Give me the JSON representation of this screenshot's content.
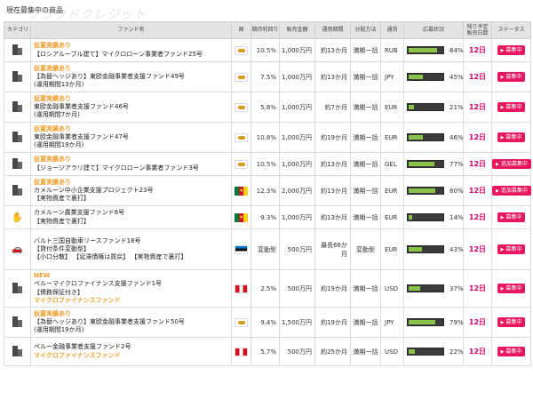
{
  "page": {
    "title": "現在募集中の商品"
  },
  "columns": {
    "category": "カテゴリ",
    "fund": "ファンド名",
    "country": "国",
    "yield": "期待利回り",
    "amount": "販売金額",
    "period": "運用期間",
    "distribution": "分配方法",
    "currency": "通貨",
    "progress": "応募状況",
    "days_line1": "残り予定",
    "days_line2": "販売日数",
    "status": "ステータス"
  },
  "colors": {
    "accent_pink": "#e8175d",
    "days_pink": "#d6006e",
    "badge_orange": "#f0a030",
    "bar_green": "#8bc34a"
  },
  "rows": [
    {
      "icon": "building-icon",
      "badge": "仮置実績あり",
      "name": "【ロシアルーブル建て】マイクロローン事業者ファンド25号",
      "sub": "",
      "tag": "",
      "flag": "cy",
      "yield": "10.5%",
      "amount": "1,000万円",
      "period": "約13か月",
      "dist": "満期一括",
      "currency": "RUB",
      "progress": 0.84,
      "pct": "84%",
      "days": "12日",
      "status": "募集中"
    },
    {
      "icon": "building-icon",
      "badge": "仮置実績あり",
      "name": "【為替ヘッジあり】東欧金融事業者支援ファンド49号",
      "sub": "(運用期間13か月)",
      "tag": "",
      "flag": "cy",
      "yield": "7.5%",
      "amount": "1,000万円",
      "period": "約13か月",
      "dist": "満期一括",
      "currency": "JPY",
      "progress": 0.45,
      "pct": "45%",
      "days": "12日",
      "status": "募集中"
    },
    {
      "icon": "building-icon",
      "badge": "仮置実績あり",
      "name": "東欧金融事業者支援ファンド46号",
      "sub": "(運用期間7か月)",
      "tag": "",
      "flag": "cy",
      "yield": "5.8%",
      "amount": "1,000万円",
      "period": "約7か月",
      "dist": "満期一括",
      "currency": "EUR",
      "progress": 0.21,
      "pct": "21%",
      "days": "12日",
      "status": "募集中"
    },
    {
      "icon": "building-icon",
      "badge": "仮置実績あり",
      "name": "東欧金融事業者支援ファンド47号",
      "sub": "(運用期間19か月)",
      "tag": "",
      "flag": "cy",
      "yield": "10.8%",
      "amount": "1,000万円",
      "period": "約19か月",
      "dist": "満期一括",
      "currency": "EUR",
      "progress": 0.46,
      "pct": "46%",
      "days": "12日",
      "status": "募集中"
    },
    {
      "icon": "building-icon",
      "badge": "仮置実績あり",
      "name": "【ジョージアラリ建て】マイクロローン事業者ファンド3号",
      "sub": "",
      "tag": "",
      "flag": "cy",
      "yield": "10.5%",
      "amount": "1,000万円",
      "period": "約13か月",
      "dist": "満期一括",
      "currency": "GEL",
      "progress": 0.77,
      "pct": "77%",
      "days": "12日",
      "status": "追加募集中"
    },
    {
      "icon": "building-icon",
      "badge": "仮置実績あり",
      "name": "カメルーン中小企業支援プロジェクト23号",
      "sub": "【実物資産で裏打】",
      "tag": "",
      "flag": "cm",
      "yield": "12.3%",
      "amount": "2,000万円",
      "period": "約13か月",
      "dist": "満期一括",
      "currency": "EUR",
      "progress": 0.8,
      "pct": "80%",
      "days": "12日",
      "status": "追加募集中"
    },
    {
      "icon": "hand-plant-icon",
      "badge": "",
      "name": "カメルーン農業支援ファンド6号",
      "sub": "【実物資産で裏打】",
      "tag": "",
      "flag": "cm",
      "yield": "9.3%",
      "amount": "1,000万円",
      "period": "約13か月",
      "dist": "満期一括",
      "currency": "EUR",
      "progress": 0.14,
      "pct": "14%",
      "days": "12日",
      "status": "募集中"
    },
    {
      "icon": "car-icon",
      "badge": "",
      "name": "バルト三国自動車リースファンド18号",
      "sub": "【貸付条件変動型】",
      "sub2": "【小口分散】 【延滞債権は買戻】 【実物資産で裏打】",
      "tag": "",
      "flag": "ee",
      "yield": "変動型",
      "amount": "500万円",
      "period": "最長66か月",
      "dist": "変動型",
      "currency": "EUR",
      "progress": 0.43,
      "pct": "43%",
      "days": "12日",
      "status": "募集中"
    },
    {
      "icon": "building-icon",
      "badge": "NEW",
      "name": "ペルーマイクロファイナンス支援ファンド1号",
      "sub": "【債務保証付き】",
      "tag": "マイクロファイナンスファンド",
      "flag": "pe",
      "yield": "2.5%",
      "amount": "500万円",
      "period": "約19か月",
      "dist": "満期一括",
      "currency": "USD",
      "progress": 0.37,
      "pct": "37%",
      "days": "12日",
      "status": "募集中"
    },
    {
      "icon": "building-icon",
      "badge": "仮置実績あり",
      "name": "【為替ヘッジあり】東欧金融事業者支援ファンド50号",
      "sub": "(運用期間19か月)",
      "tag": "",
      "flag": "cy",
      "yield": "9.4%",
      "amount": "1,500万円",
      "period": "約19か月",
      "dist": "満期一括",
      "currency": "JPY",
      "progress": 0.79,
      "pct": "79%",
      "days": "12日",
      "status": "募集中"
    },
    {
      "icon": "building-icon",
      "badge": "",
      "name": "ペルー金融事業者支援ファンド2号",
      "sub": "",
      "tag": "マイクロファイナンスファンド",
      "flag": "pe",
      "yield": "5.7%",
      "amount": "500万円",
      "period": "約25か月",
      "dist": "満期一括",
      "currency": "USD",
      "progress": 0.22,
      "pct": "22%",
      "days": "12日",
      "status": "募集中"
    }
  ]
}
